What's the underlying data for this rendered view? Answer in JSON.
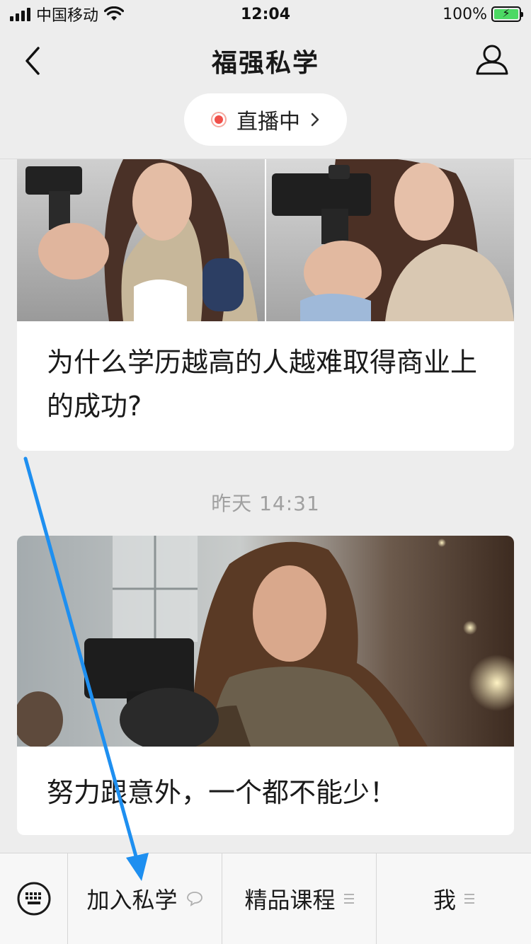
{
  "status_bar": {
    "carrier": "中国移动",
    "time": "12:04",
    "battery": "100%"
  },
  "nav": {
    "title": "福强私学"
  },
  "live": {
    "label": "直播中"
  },
  "messages": [
    {
      "title": "为什么学历越高的人越难取得商业上的成功?"
    },
    {
      "timestamp": "昨天 14:31",
      "title": "努力跟意外，一个都不能少！"
    }
  ],
  "bottom_menu": {
    "items": [
      {
        "label": "加入私学",
        "icon": "chat-bubble-icon"
      },
      {
        "label": "精品课程",
        "icon": "menu-lines-icon"
      },
      {
        "label": "我",
        "icon": "menu-lines-icon"
      }
    ]
  },
  "colors": {
    "background": "#ededed",
    "live_dot": "#f0504a",
    "annotation_arrow": "#1e8ff0"
  }
}
